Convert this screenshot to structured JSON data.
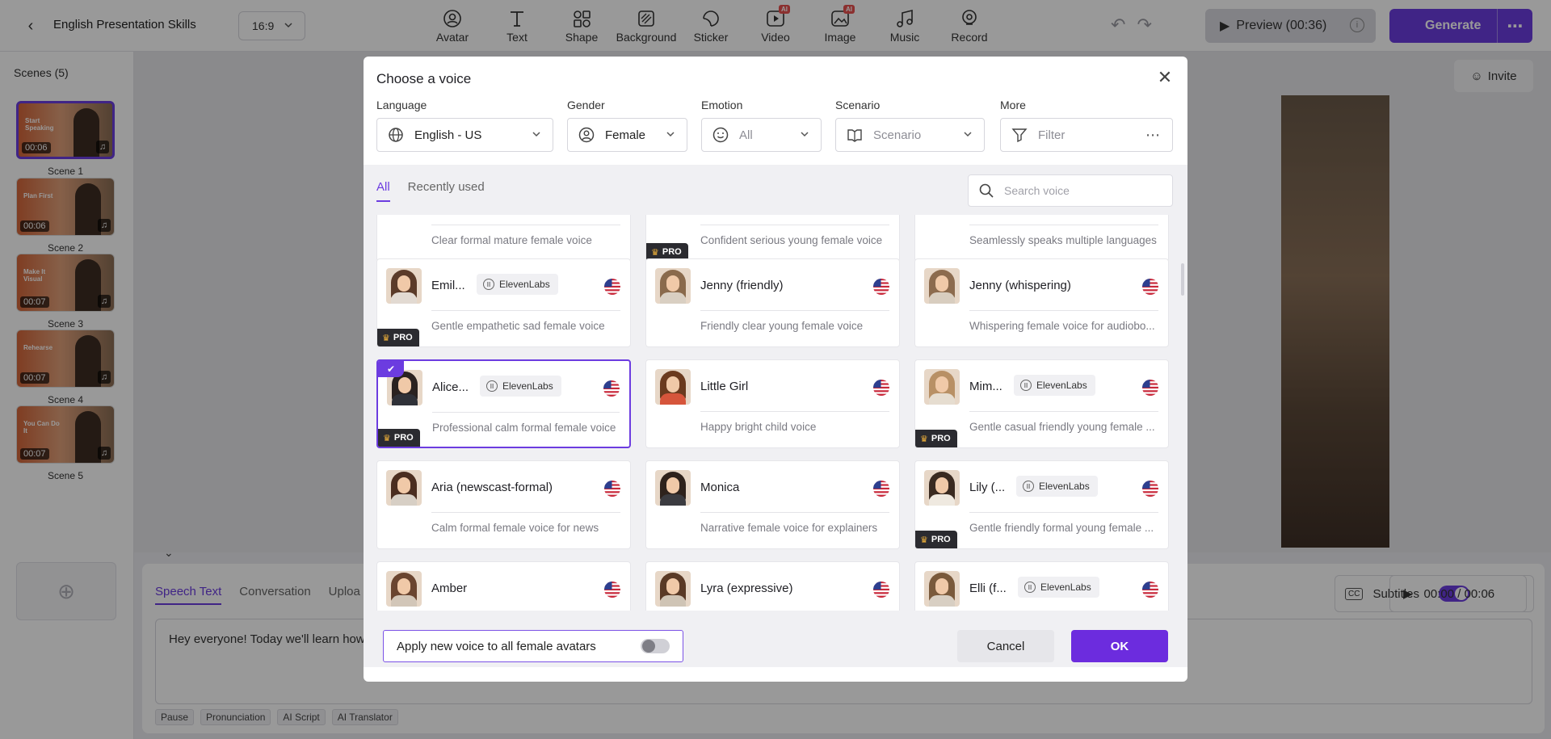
{
  "app": {
    "project_title": "English Presentation Skills",
    "aspect_ratio": "16:9",
    "tools": [
      {
        "label": "Avatar",
        "icon": "avatar-icon",
        "ai": ""
      },
      {
        "label": "Text",
        "icon": "text-icon",
        "ai": ""
      },
      {
        "label": "Shape",
        "icon": "shape-icon",
        "ai": ""
      },
      {
        "label": "Background",
        "icon": "background-icon",
        "ai": ""
      },
      {
        "label": "Sticker",
        "icon": "sticker-icon",
        "ai": ""
      },
      {
        "label": "Video",
        "icon": "video-icon",
        "ai": "AI"
      },
      {
        "label": "Image",
        "icon": "image-icon",
        "ai": "AI"
      },
      {
        "label": "Music",
        "icon": "music-icon",
        "ai": ""
      },
      {
        "label": "Record",
        "icon": "record-icon",
        "ai": ""
      }
    ],
    "preview_label": "Preview (00:36)",
    "generate_label": "Generate",
    "invite_label": "Invite",
    "accent_color": "#6c3ce0"
  },
  "scenes": {
    "title": "Scenes (5)",
    "items": [
      {
        "name": "Scene 1",
        "duration": "00:06",
        "thumb_text": "Start Speaking"
      },
      {
        "name": "Scene 2",
        "duration": "00:06",
        "thumb_text": "Plan First"
      },
      {
        "name": "Scene 3",
        "duration": "00:07",
        "thumb_text": "Make It Visual"
      },
      {
        "name": "Scene 4",
        "duration": "00:07",
        "thumb_text": "Rehearse"
      },
      {
        "name": "Scene 5",
        "duration": "00:07",
        "thumb_text": "You Can Do It"
      }
    ]
  },
  "bottom": {
    "tabs": [
      "Speech Text",
      "Conversation",
      "Uploa"
    ],
    "speech_text": "Hey everyone! Today we'll learn how",
    "tools": [
      "Pause",
      "Pronunciation",
      "AI Script",
      "AI Translator"
    ],
    "subtitles_label": "Subtitles",
    "subtitles_on": true,
    "time": "00:00 / 00:06"
  },
  "modal": {
    "title": "Choose a voice",
    "filters": [
      {
        "label": "Language",
        "value": "English - US",
        "placeholder": false,
        "icon": "globe-icon"
      },
      {
        "label": "Gender",
        "value": "Female",
        "placeholder": false,
        "icon": "person-icon"
      },
      {
        "label": "Emotion",
        "value": "All",
        "placeholder": true,
        "icon": "smile-icon"
      },
      {
        "label": "Scenario",
        "value": "Scenario",
        "placeholder": true,
        "icon": "book-icon"
      },
      {
        "label": "More",
        "value": "Filter",
        "placeholder": true,
        "icon": "filter-icon"
      }
    ],
    "tabs": [
      "All",
      "Recently used"
    ],
    "search_placeholder": "Search voice",
    "voices": [
      {
        "name": "",
        "tag": "",
        "desc": "Clear formal mature female voice",
        "pro": false,
        "selected": false,
        "partial": true,
        "hair": "#5a3c2a",
        "body": "#c9c0b5"
      },
      {
        "name": "",
        "tag": "",
        "desc": "Confident serious young female voice",
        "pro": true,
        "selected": false,
        "partial": true,
        "hair": "#3a2a22",
        "body": "#d8d0c8"
      },
      {
        "name": "",
        "tag": "",
        "desc": "Seamlessly speaks multiple languages",
        "pro": false,
        "selected": false,
        "partial": true,
        "hair": "#4a3428",
        "body": "#cfc7bc"
      },
      {
        "name": "Emil...",
        "tag": "ElevenLabs",
        "desc": "Gentle empathetic sad female voice",
        "pro": true,
        "selected": false,
        "partial": false,
        "hair": "#5b3b29",
        "body": "#e2dad2"
      },
      {
        "name": "Jenny (friendly)",
        "tag": "",
        "desc": "Friendly clear young female voice",
        "pro": false,
        "selected": false,
        "partial": false,
        "hair": "#8a6a4c",
        "body": "#d9cfc2"
      },
      {
        "name": "Jenny (whispering)",
        "tag": "",
        "desc": "Whispering female voice for audiobo...",
        "pro": false,
        "selected": false,
        "partial": false,
        "hair": "#8c6b4e",
        "body": "#d8cdbf"
      },
      {
        "name": "Alice...",
        "tag": "ElevenLabs",
        "desc": "Professional calm formal female voice",
        "pro": true,
        "selected": true,
        "partial": false,
        "hair": "#2a2220",
        "body": "#2f3138"
      },
      {
        "name": "Little Girl",
        "tag": "",
        "desc": "Happy bright child voice",
        "pro": false,
        "selected": false,
        "partial": false,
        "hair": "#6b3a1e",
        "body": "#d6553b"
      },
      {
        "name": "Mim...",
        "tag": "ElevenLabs",
        "desc": "Gentle casual friendly young female ...",
        "pro": true,
        "selected": false,
        "partial": false,
        "hair": "#b89065",
        "body": "#e6ddd0"
      },
      {
        "name": "Aria (newscast-formal)",
        "tag": "",
        "desc": "Calm formal female voice for news",
        "pro": false,
        "selected": false,
        "partial": false,
        "hair": "#4b2e20",
        "body": "#d7cfc5"
      },
      {
        "name": "Monica",
        "tag": "",
        "desc": "Narrative female voice for explainers",
        "pro": false,
        "selected": false,
        "partial": false,
        "hair": "#2e221c",
        "body": "#3b3b40"
      },
      {
        "name": "Lily (...",
        "tag": "ElevenLabs",
        "desc": "Gentle friendly formal young female ...",
        "pro": true,
        "selected": false,
        "partial": false,
        "hair": "#3a2a20",
        "body": "#efe9e0"
      },
      {
        "name": "Amber",
        "tag": "",
        "desc": "",
        "pro": false,
        "selected": false,
        "partial": false,
        "hair": "#6a4530",
        "body": "#d2c6b8"
      },
      {
        "name": "Lyra (expressive)",
        "tag": "",
        "desc": "",
        "pro": false,
        "selected": false,
        "partial": false,
        "hair": "#5a3a26",
        "body": "#cfc4b5"
      },
      {
        "name": "Elli (f...",
        "tag": "ElevenLabs",
        "desc": "",
        "pro": false,
        "selected": false,
        "partial": false,
        "hair": "#7a5a3c",
        "body": "#d8cfc3"
      }
    ],
    "pro_label": "PRO",
    "apply_label": "Apply new voice to all female avatars",
    "apply_on": false,
    "cancel_label": "Cancel",
    "ok_label": "OK"
  }
}
